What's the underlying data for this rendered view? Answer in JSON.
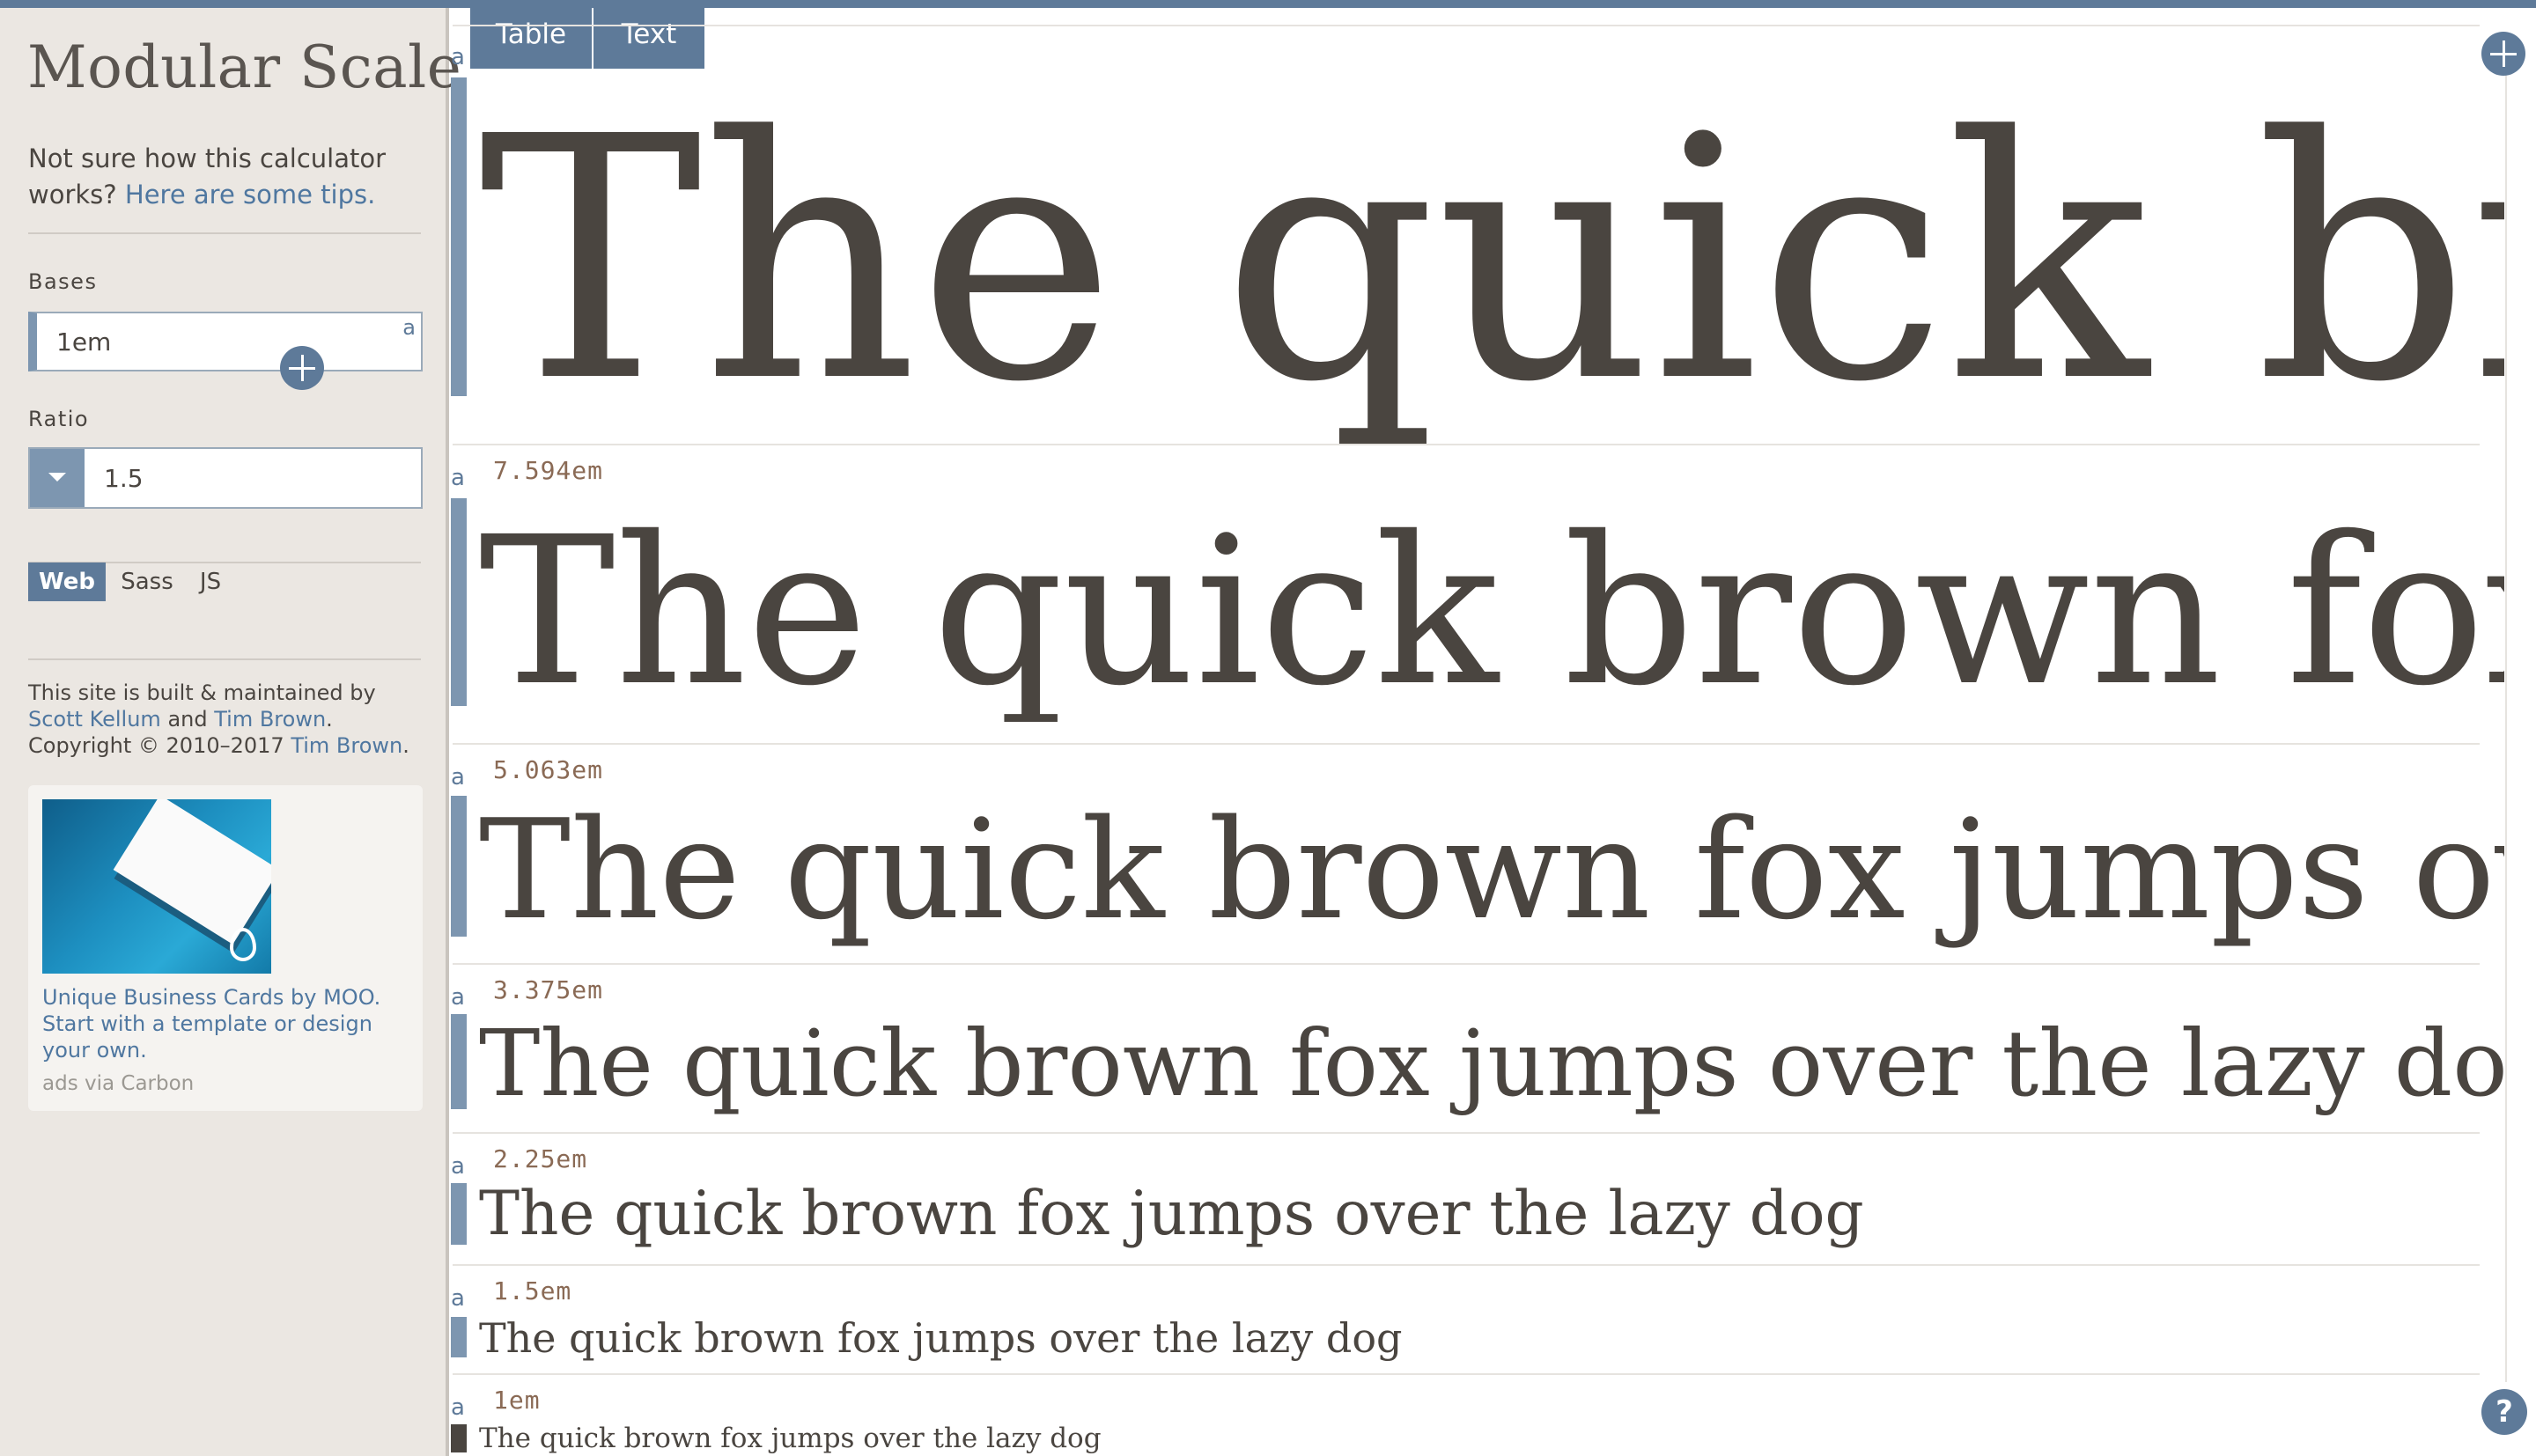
{
  "app": {
    "title": "Modular Scale"
  },
  "sidebar": {
    "intro_text": "Not sure how this calculator works?",
    "intro_link": "Here are some tips.",
    "bases_label": "Bases",
    "bases_value": "1em",
    "bases_marker": "a",
    "ratio_label": "Ratio",
    "ratio_value": "1.5",
    "output_tabs": [
      "Web",
      "Sass",
      "JS"
    ],
    "active_output_tab": "Web",
    "credit": {
      "prefix": "This site is built & maintained by",
      "author1": "Scott Kellum",
      "and": "and",
      "author2": "Tim Brown",
      "copyright": ". Copyright © 2010–2017",
      "author3": "Tim Brown",
      "period": "."
    },
    "ad": {
      "text": "Unique Business Cards by MOO. Start with a template or design your own.",
      "via": "ads via Carbon"
    }
  },
  "top_tabs": [
    "Table",
    "Text"
  ],
  "scale_rows": [
    {
      "marker": "a",
      "size": "",
      "text": "The quick brown fox jumps over the lazy dog"
    },
    {
      "marker": "a",
      "size": "7.594em",
      "text": "The quick brown fox jumps over the lazy dog"
    },
    {
      "marker": "a",
      "size": "5.063em",
      "text": "The quick brown fox jumps over the lazy dog"
    },
    {
      "marker": "a",
      "size": "3.375em",
      "text": "The quick brown fox jumps over the lazy dog"
    },
    {
      "marker": "a",
      "size": "2.25em",
      "text": "The quick brown fox jumps over the lazy dog"
    },
    {
      "marker": "a",
      "size": "1.5em",
      "text": "The quick brown fox jumps over the lazy dog"
    },
    {
      "marker": "a",
      "size": "1em",
      "text": "The quick brown fox jumps over the lazy dog"
    }
  ],
  "help_label": "?",
  "colors": {
    "accent": "#5e7a99",
    "sidebar_bg": "#ebe7e2",
    "text": "#4a4540",
    "link": "#4f77a0"
  }
}
